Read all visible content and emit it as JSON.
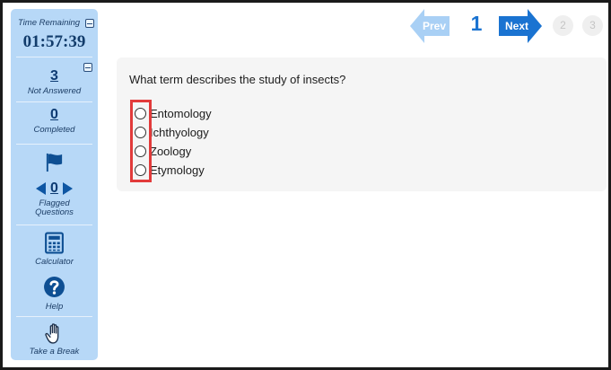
{
  "sidebar": {
    "time_remaining_label": "Time Remaining",
    "timer": "01:57:39",
    "not_answered": {
      "count": "3",
      "label": "Not Answered"
    },
    "completed": {
      "count": "0",
      "label": "Completed"
    },
    "flagged": {
      "count": "0",
      "label_line1": "Flagged",
      "label_line2": "Questions"
    },
    "tools": {
      "calculator": "Calculator",
      "help": "Help",
      "take_break": "Take a Break"
    }
  },
  "pager": {
    "prev_label": "Prev",
    "next_label": "Next",
    "current_page": "1",
    "pages": [
      "2",
      "3"
    ]
  },
  "question": {
    "text": "What term describes the study of insects?",
    "options": [
      "Entomology",
      "Ichthyology",
      "Zoology",
      "Etymology"
    ]
  },
  "colors": {
    "sidebar_bg": "#b7d8f7",
    "accent_blue": "#1a73d1",
    "prev_disabled": "#a9d0f5",
    "highlight_red": "#e23b3b"
  }
}
